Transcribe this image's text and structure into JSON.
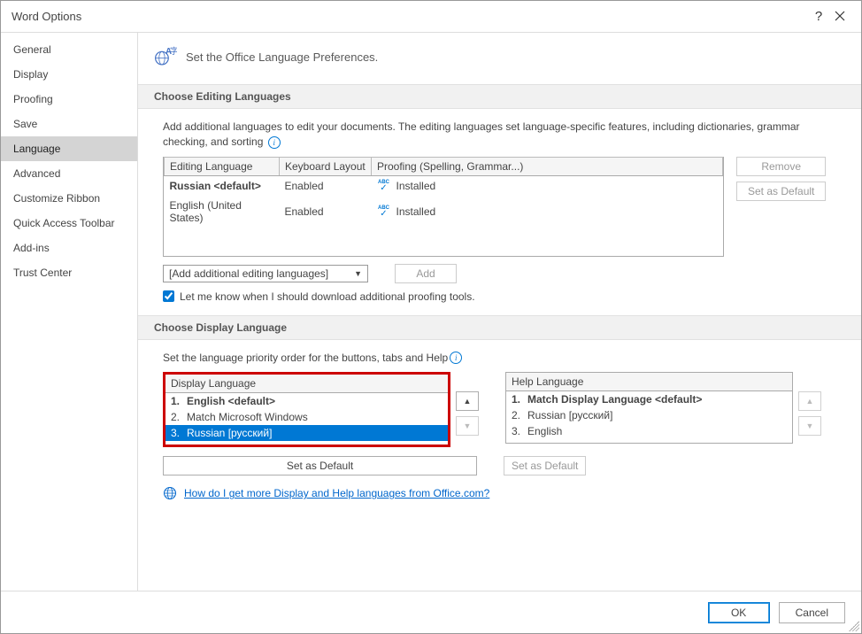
{
  "title": "Word Options",
  "sidebar": {
    "items": [
      {
        "label": "General"
      },
      {
        "label": "Display"
      },
      {
        "label": "Proofing"
      },
      {
        "label": "Save"
      },
      {
        "label": "Language"
      },
      {
        "label": "Advanced"
      },
      {
        "label": "Customize Ribbon"
      },
      {
        "label": "Quick Access Toolbar"
      },
      {
        "label": "Add-ins"
      },
      {
        "label": "Trust Center"
      }
    ],
    "selected": "Language"
  },
  "header_text": "Set the Office Language Preferences.",
  "sections": {
    "editing": {
      "title": "Choose Editing Languages",
      "desc": "Add additional languages to edit your documents. The editing languages set language-specific features, including dictionaries, grammar checking, and sorting",
      "columns": {
        "lang": "Editing Language",
        "kb": "Keyboard Layout",
        "proof": "Proofing (Spelling, Grammar...)"
      },
      "rows": [
        {
          "lang": "Russian <default>",
          "kb": "Enabled",
          "proof": "Installed",
          "bold": true
        },
        {
          "lang": "English (United States)",
          "kb": "Enabled",
          "proof": "Installed",
          "bold": false
        }
      ],
      "add_placeholder": "[Add additional editing languages]",
      "add_btn": "Add",
      "remove_btn": "Remove",
      "setdef_btn": "Set as Default",
      "checkbox": "Let me know when I should download additional proofing tools."
    },
    "display": {
      "title": "Choose Display Language",
      "desc": "Set the language priority order for the buttons, tabs and Help",
      "left": {
        "header": "Display Language",
        "items": [
          {
            "n": "1.",
            "t": "English <default>",
            "bold": true
          },
          {
            "n": "2.",
            "t": "Match Microsoft Windows",
            "bold": false
          },
          {
            "n": "3.",
            "t": "Russian [русский]",
            "bold": false,
            "selected": true
          }
        ]
      },
      "right": {
        "header": "Help Language",
        "items": [
          {
            "n": "1.",
            "t": "Match Display Language <default>",
            "bold": true
          },
          {
            "n": "2.",
            "t": "Russian [русский]",
            "bold": false
          },
          {
            "n": "3.",
            "t": "English",
            "bold": false
          }
        ]
      },
      "setdef_btn": "Set as Default",
      "link": "How do I get more Display and Help languages from Office.com?"
    }
  },
  "buttons": {
    "ok": "OK",
    "cancel": "Cancel"
  }
}
